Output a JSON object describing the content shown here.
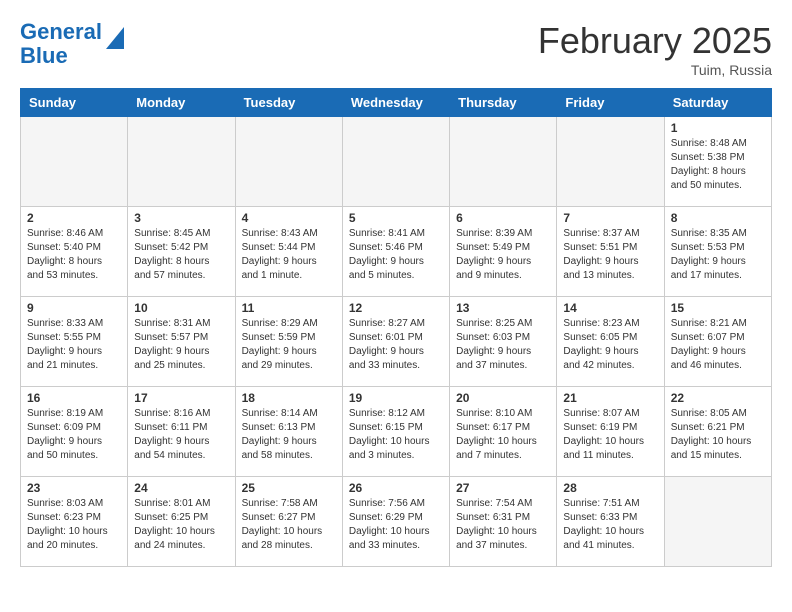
{
  "header": {
    "logo_line1": "General",
    "logo_line2": "Blue",
    "month_title": "February 2025",
    "location": "Tuim, Russia"
  },
  "days_of_week": [
    "Sunday",
    "Monday",
    "Tuesday",
    "Wednesday",
    "Thursday",
    "Friday",
    "Saturday"
  ],
  "weeks": [
    [
      {
        "day": "",
        "empty": true
      },
      {
        "day": "",
        "empty": true
      },
      {
        "day": "",
        "empty": true
      },
      {
        "day": "",
        "empty": true
      },
      {
        "day": "",
        "empty": true
      },
      {
        "day": "",
        "empty": true
      },
      {
        "day": "1",
        "info": "Sunrise: 8:48 AM\nSunset: 5:38 PM\nDaylight: 8 hours and 50 minutes."
      }
    ],
    [
      {
        "day": "2",
        "info": "Sunrise: 8:46 AM\nSunset: 5:40 PM\nDaylight: 8 hours and 53 minutes."
      },
      {
        "day": "3",
        "info": "Sunrise: 8:45 AM\nSunset: 5:42 PM\nDaylight: 8 hours and 57 minutes."
      },
      {
        "day": "4",
        "info": "Sunrise: 8:43 AM\nSunset: 5:44 PM\nDaylight: 9 hours and 1 minute."
      },
      {
        "day": "5",
        "info": "Sunrise: 8:41 AM\nSunset: 5:46 PM\nDaylight: 9 hours and 5 minutes."
      },
      {
        "day": "6",
        "info": "Sunrise: 8:39 AM\nSunset: 5:49 PM\nDaylight: 9 hours and 9 minutes."
      },
      {
        "day": "7",
        "info": "Sunrise: 8:37 AM\nSunset: 5:51 PM\nDaylight: 9 hours and 13 minutes."
      },
      {
        "day": "8",
        "info": "Sunrise: 8:35 AM\nSunset: 5:53 PM\nDaylight: 9 hours and 17 minutes."
      }
    ],
    [
      {
        "day": "9",
        "info": "Sunrise: 8:33 AM\nSunset: 5:55 PM\nDaylight: 9 hours and 21 minutes."
      },
      {
        "day": "10",
        "info": "Sunrise: 8:31 AM\nSunset: 5:57 PM\nDaylight: 9 hours and 25 minutes."
      },
      {
        "day": "11",
        "info": "Sunrise: 8:29 AM\nSunset: 5:59 PM\nDaylight: 9 hours and 29 minutes."
      },
      {
        "day": "12",
        "info": "Sunrise: 8:27 AM\nSunset: 6:01 PM\nDaylight: 9 hours and 33 minutes."
      },
      {
        "day": "13",
        "info": "Sunrise: 8:25 AM\nSunset: 6:03 PM\nDaylight: 9 hours and 37 minutes."
      },
      {
        "day": "14",
        "info": "Sunrise: 8:23 AM\nSunset: 6:05 PM\nDaylight: 9 hours and 42 minutes."
      },
      {
        "day": "15",
        "info": "Sunrise: 8:21 AM\nSunset: 6:07 PM\nDaylight: 9 hours and 46 minutes."
      }
    ],
    [
      {
        "day": "16",
        "info": "Sunrise: 8:19 AM\nSunset: 6:09 PM\nDaylight: 9 hours and 50 minutes."
      },
      {
        "day": "17",
        "info": "Sunrise: 8:16 AM\nSunset: 6:11 PM\nDaylight: 9 hours and 54 minutes."
      },
      {
        "day": "18",
        "info": "Sunrise: 8:14 AM\nSunset: 6:13 PM\nDaylight: 9 hours and 58 minutes."
      },
      {
        "day": "19",
        "info": "Sunrise: 8:12 AM\nSunset: 6:15 PM\nDaylight: 10 hours and 3 minutes."
      },
      {
        "day": "20",
        "info": "Sunrise: 8:10 AM\nSunset: 6:17 PM\nDaylight: 10 hours and 7 minutes."
      },
      {
        "day": "21",
        "info": "Sunrise: 8:07 AM\nSunset: 6:19 PM\nDaylight: 10 hours and 11 minutes."
      },
      {
        "day": "22",
        "info": "Sunrise: 8:05 AM\nSunset: 6:21 PM\nDaylight: 10 hours and 15 minutes."
      }
    ],
    [
      {
        "day": "23",
        "info": "Sunrise: 8:03 AM\nSunset: 6:23 PM\nDaylight: 10 hours and 20 minutes."
      },
      {
        "day": "24",
        "info": "Sunrise: 8:01 AM\nSunset: 6:25 PM\nDaylight: 10 hours and 24 minutes."
      },
      {
        "day": "25",
        "info": "Sunrise: 7:58 AM\nSunset: 6:27 PM\nDaylight: 10 hours and 28 minutes."
      },
      {
        "day": "26",
        "info": "Sunrise: 7:56 AM\nSunset: 6:29 PM\nDaylight: 10 hours and 33 minutes."
      },
      {
        "day": "27",
        "info": "Sunrise: 7:54 AM\nSunset: 6:31 PM\nDaylight: 10 hours and 37 minutes."
      },
      {
        "day": "28",
        "info": "Sunrise: 7:51 AM\nSunset: 6:33 PM\nDaylight: 10 hours and 41 minutes."
      },
      {
        "day": "",
        "empty": true
      }
    ]
  ]
}
